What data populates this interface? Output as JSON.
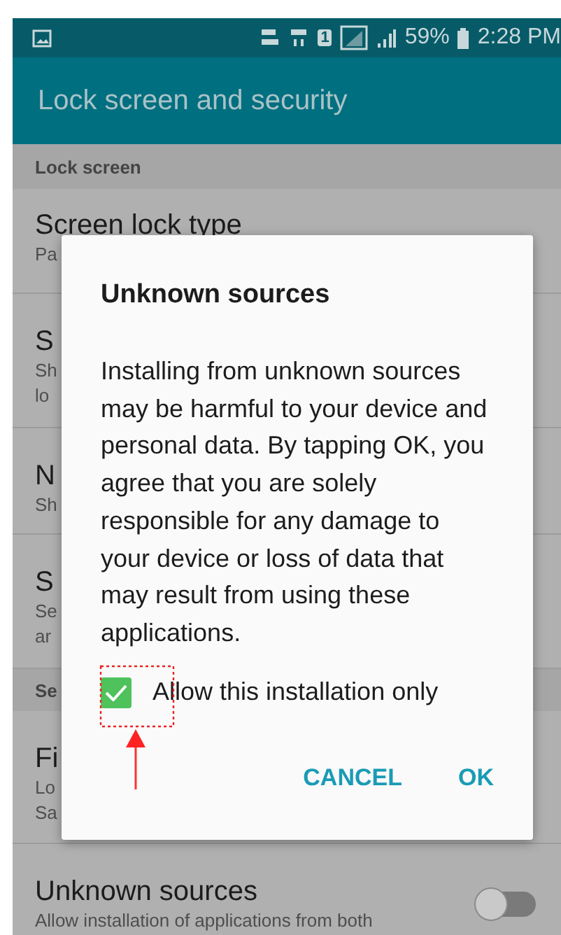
{
  "status_bar": {
    "sim": "1",
    "battery": "59%",
    "time": "2:28 PM"
  },
  "app_bar": {
    "title": "Lock screen and security"
  },
  "list": [
    {
      "kind": "header",
      "title": "Lock screen"
    },
    {
      "kind": "item",
      "title": "Screen lock type",
      "lines": [
        "Pa"
      ]
    },
    {
      "kind": "item",
      "title": "S",
      "lines": [
        "Sh",
        "lo"
      ]
    },
    {
      "kind": "item",
      "title": "N",
      "lines": [
        "Sh"
      ]
    },
    {
      "kind": "item",
      "title": "S",
      "lines": [
        "Se",
        "ar"
      ]
    },
    {
      "kind": "header",
      "title": "Se"
    },
    {
      "kind": "item",
      "title": "Fi",
      "lines": [
        "Lo",
        "Sa"
      ]
    },
    {
      "kind": "toggle",
      "title": "Unknown sources",
      "lines": [
        "Allow installation of applications from both"
      ],
      "on": false
    }
  ],
  "dialog": {
    "title": "Unknown sources",
    "message": "Installing from unknown sources may be harmful to your device and personal data. By tapping OK, you agree that you are solely responsible for any damage to your device or loss of data that may result from using these applications.",
    "checkbox": {
      "label": "Allow this installation only",
      "checked": true
    },
    "buttons": [
      "CANCEL",
      "OK"
    ]
  }
}
